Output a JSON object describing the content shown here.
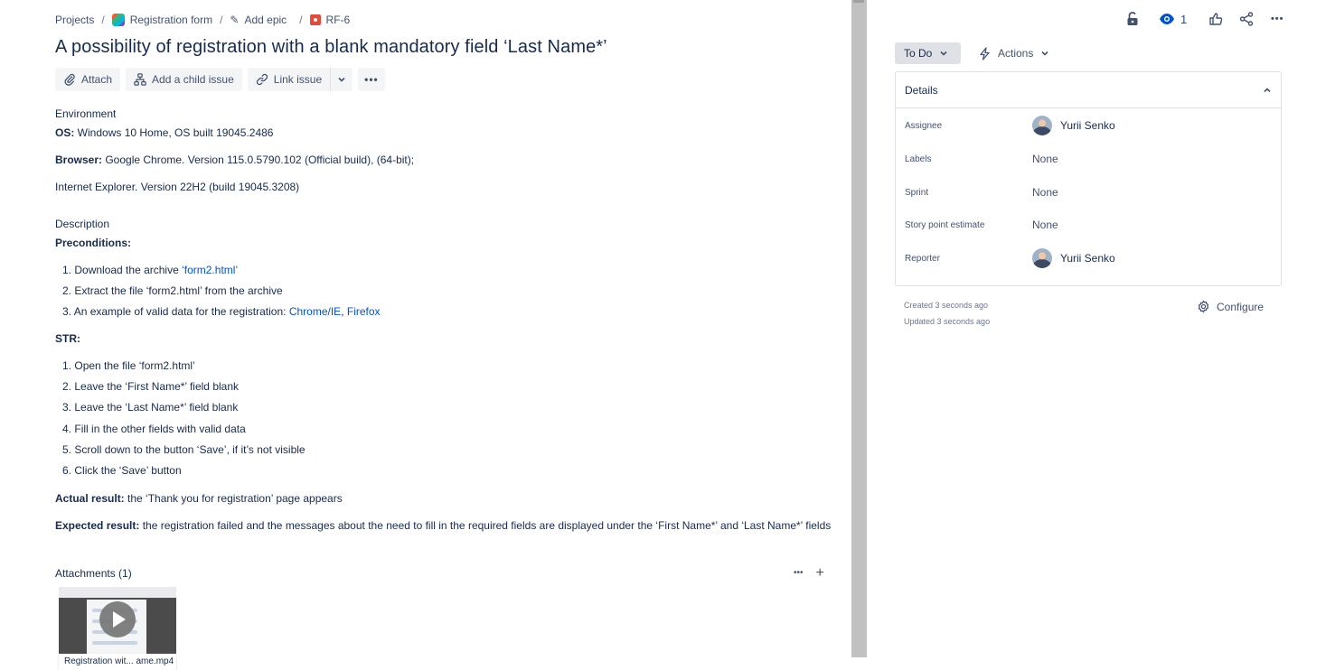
{
  "breadcrumb": {
    "projects": "Projects",
    "project": "Registration form",
    "epic": "Add epic",
    "issue_key": "RF-6",
    "separator": "/"
  },
  "issue": {
    "title": "A possibility of registration with a blank mandatory field ‘Last Name*’"
  },
  "toolbar": {
    "attach": "Attach",
    "add_child": "Add a child issue",
    "link_issue": "Link issue",
    "more": "•••"
  },
  "environment": {
    "heading": "Environment",
    "os_label": "OS:",
    "os_value": " Windows 10 Home, OS built 19045.2486",
    "browser_label": "Browser:",
    "browser_value": " Google Chrome. Version 115.0.5790.102 (Official build), (64-bit);",
    "ie_line": "Internet Explorer. Version 22H2 (build 19045.3208)"
  },
  "description": {
    "heading": "Description",
    "preconditions_label": "Preconditions:",
    "preconditions": [
      {
        "num": "1.",
        "text": "Download the archive ",
        "link": "‘form2.html’",
        "link2": ""
      },
      {
        "num": "2.",
        "text": "Extract the file ‘form2.html’ from the archive",
        "link": "",
        "link2": ""
      },
      {
        "num": "3.",
        "text": "An example of valid data for the registration: ",
        "link": "Chrome/IE",
        "link2": "Firefox"
      }
    ],
    "str_label": "STR:",
    "steps": [
      {
        "num": "1.",
        "text": "Open the file ‘form2.html’"
      },
      {
        "num": "2.",
        "text": "Leave the ‘First Name*’ field blank"
      },
      {
        "num": "3.",
        "text": "Leave the ‘Last Name*’ field blank"
      },
      {
        "num": "4.",
        "text": "Fill in the other fields with valid data"
      },
      {
        "num": "5.",
        "text": "Scroll down to the button ‘Save’, if it’s not visible"
      },
      {
        "num": "6.",
        "text": "Click the ‘Save’ button"
      }
    ],
    "actual_label": "Actual result:",
    "actual_value": " the ‘Thank you for registration’ page appears",
    "expected_label": "Expected result:",
    "expected_value": " the registration failed and the messages about the need to fill in the required fields are displayed under the ‘First Name*’ and ‘Last Name*’ fields"
  },
  "attachments": {
    "heading": "Attachments (1)",
    "more": "•••",
    "add": "+",
    "file_name": "Registration wit... ame.mp4"
  },
  "right": {
    "watch_count": "1",
    "status": "To Do",
    "actions": "Actions",
    "details_heading": "Details",
    "fields": [
      {
        "label": "Assignee",
        "value": "Yurii Senko",
        "avatar": true
      },
      {
        "label": "Labels",
        "value": "None",
        "avatar": false
      },
      {
        "label": "Sprint",
        "value": "None",
        "avatar": false
      },
      {
        "label": "Story point estimate",
        "value": "None",
        "avatar": false
      },
      {
        "label": "Reporter",
        "value": "Yurii Senko",
        "avatar": true
      }
    ],
    "created": "Created 3 seconds ago",
    "updated": "Updated 3 seconds ago",
    "configure": "Configure"
  },
  "colors": {
    "link": "#0052cc",
    "text": "#172b4d",
    "subtle": "#42526e",
    "bug": "#e5493a",
    "button_bg": "#f4f5f7",
    "status_bg": "#dfe1e6"
  }
}
